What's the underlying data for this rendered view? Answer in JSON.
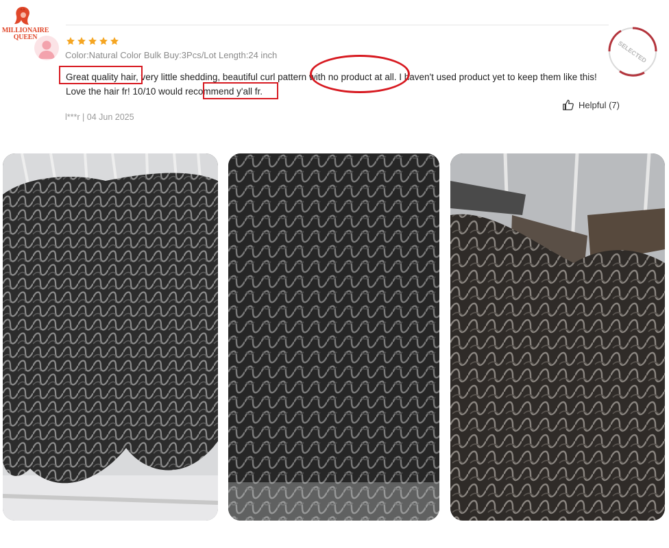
{
  "brand": {
    "logo_text_line1": "MILLIONAIRE",
    "logo_text_line2": "QUEEN"
  },
  "review": {
    "rating": 5,
    "variant": "Color:Natural Color Bulk Buy:3Pcs/Lot Length:24 inch",
    "text": "Great quality hair, very little shedding, beautiful curl pattern with no product at all. I haven't used product yet to keep them like this! Love the hair fr! 10/10 would recommend y'all fr.",
    "author": "l***r",
    "date": "04 Jun 2025",
    "helpful_label": "Helpful (7)",
    "badge": "SELECTED"
  },
  "photos": [
    {
      "alt": "Curly hair bundles hanging on rack"
    },
    {
      "alt": "Close-up of deep curly hair"
    },
    {
      "alt": "Curly hair wefts on hangers"
    }
  ],
  "colors": {
    "annotation": "#d71920",
    "star": "#f5a623",
    "brand": "#e0472a"
  }
}
